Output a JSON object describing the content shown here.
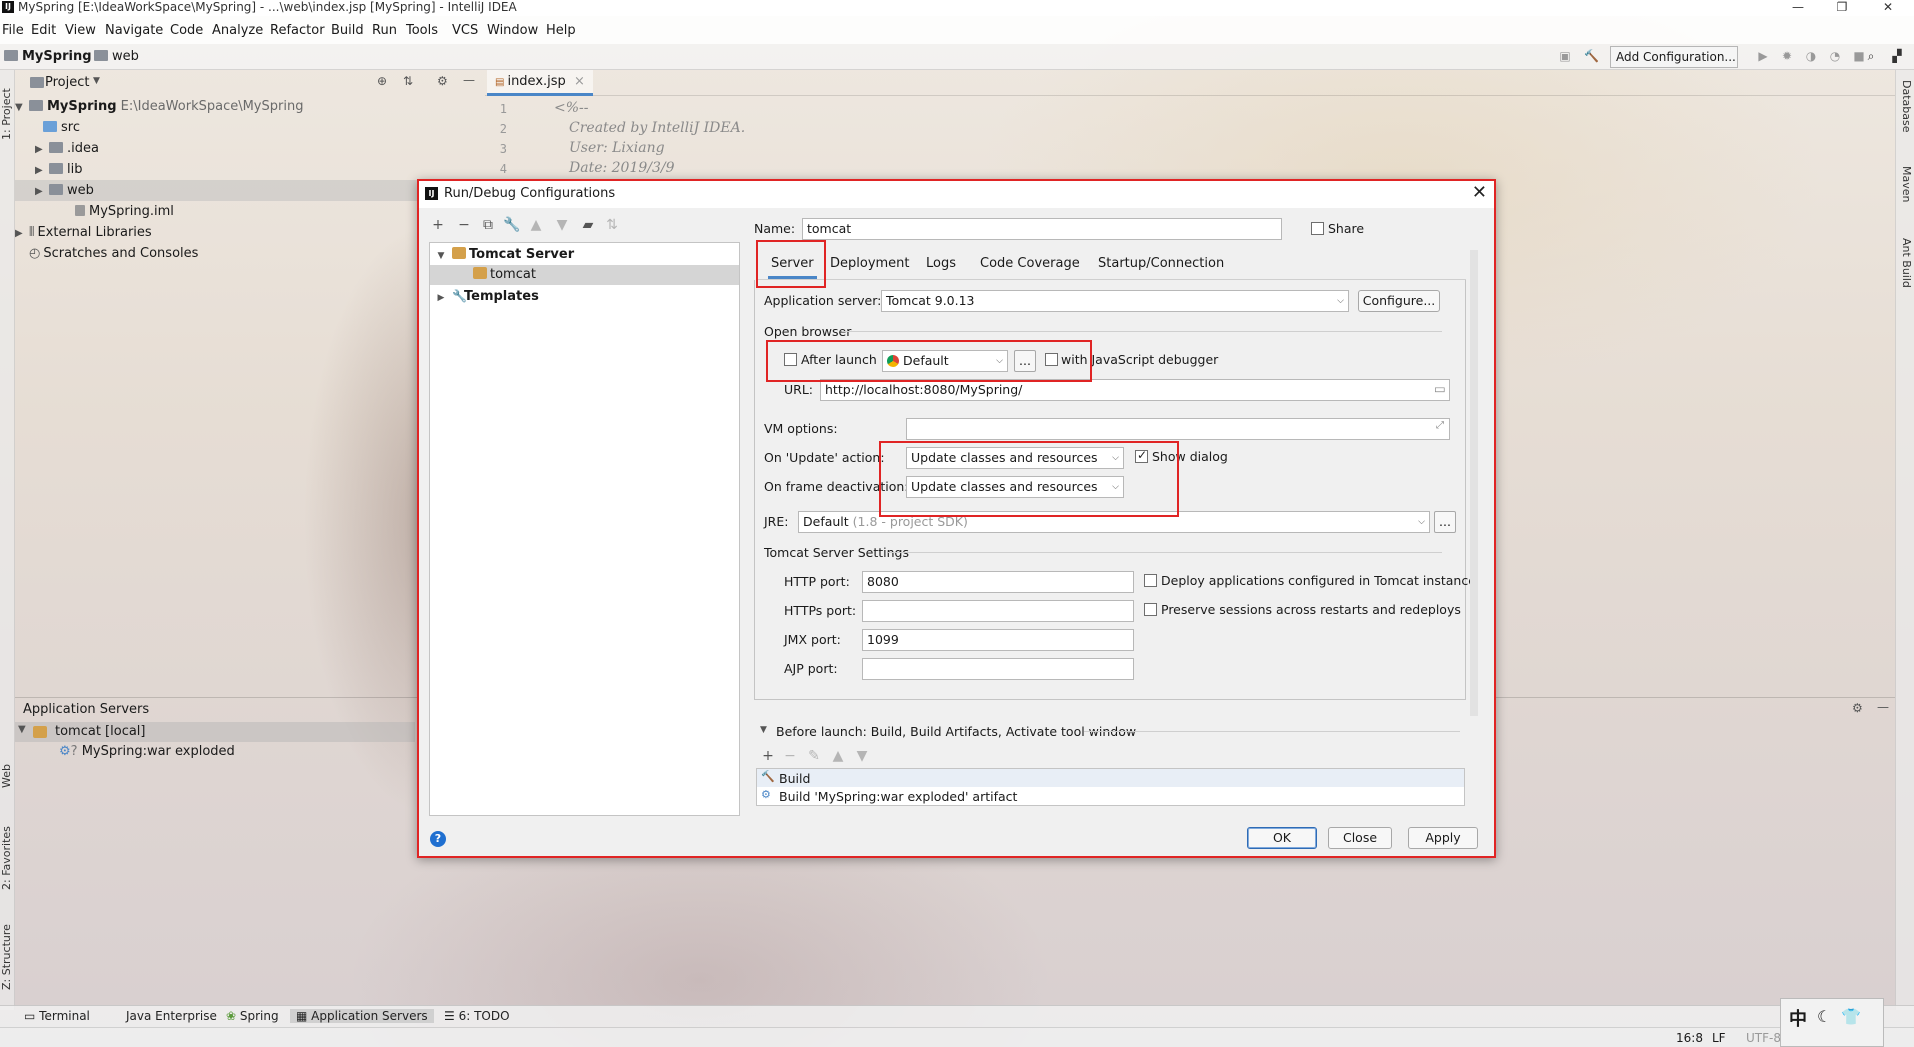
{
  "window": {
    "title": "MySpring [E:\\IdeaWorkSpace\\MySpring] - ...\\web\\index.jsp [MySpring] - IntelliJ IDEA",
    "minimize": "—",
    "restore": "❐",
    "close": "✕"
  },
  "menu": [
    "File",
    "Edit",
    "View",
    "Navigate",
    "Code",
    "Analyze",
    "Refactor",
    "Build",
    "Run",
    "Tools",
    "VCS",
    "Window",
    "Help"
  ],
  "navbar": {
    "project": "MySpring",
    "folder": "web",
    "add_config": "Add Configuration..."
  },
  "left_tabs": {
    "project": "1: Project",
    "web": "Web",
    "favorites": "2: Favorites",
    "structure": "Z: Structure"
  },
  "right_tabs": {
    "database": "Database",
    "maven": "Maven",
    "ant": "Ant Build"
  },
  "project_panel": {
    "title": "Project",
    "root": {
      "name": "MySpring",
      "path": "E:\\IdeaWorkSpace\\MySpring"
    },
    "items": [
      {
        "label": "src"
      },
      {
        "label": ".idea"
      },
      {
        "label": "lib"
      },
      {
        "label": "web"
      },
      {
        "label": "MySpring.iml"
      },
      {
        "label": "External Libraries"
      },
      {
        "label": "Scratches and Consoles"
      }
    ]
  },
  "editor": {
    "tab": "index.jsp",
    "lines": [
      "1",
      "2",
      "3",
      "4"
    ],
    "code": [
      "<%--",
      "Created by IntelliJ IDEA.",
      "User: Lixiang",
      "Date: 2019/3/9"
    ]
  },
  "app_servers": {
    "title": "Application Servers",
    "server": "tomcat [local]",
    "artifact": "MySpring:war exploded"
  },
  "bottom_tabs": [
    "Terminal",
    "Java Enterprise",
    "Spring",
    "Application Servers",
    "6: TODO"
  ],
  "status": {
    "position": "16:8",
    "line_sep": "LF",
    "encoding": "UTF-8"
  },
  "ime": "中",
  "dialog": {
    "title": "Run/Debug Configurations",
    "tree": {
      "group": "Tomcat Server",
      "config": "tomcat",
      "templates": "Templates"
    },
    "name_label": "Name:",
    "name_value": "tomcat",
    "share_label": "Share",
    "tabs": [
      "Server",
      "Deployment",
      "Logs",
      "Code Coverage",
      "Startup/Connection"
    ],
    "app_server_label": "Application server:",
    "app_server_value": "Tomcat 9.0.13",
    "configure_btn": "Configure...",
    "open_browser_label": "Open browser",
    "after_launch_label": "After launch",
    "browser_value": "Default",
    "browse_btn": "...",
    "js_debugger_label": "with JavaScript debugger",
    "url_label": "URL:",
    "url_value": "http://localhost:8080/MySpring/",
    "vm_options_label": "VM options:",
    "vm_options_value": "",
    "on_update_label": "On 'Update' action:",
    "on_update_value": "Update classes and resources",
    "show_dialog_label": "Show dialog",
    "on_frame_label": "On frame deactivation:",
    "on_frame_value": "Update classes and resources",
    "jre_label": "JRE:",
    "jre_value": "Default",
    "jre_hint": "(1.8 - project SDK)",
    "tomcat_settings_label": "Tomcat Server Settings",
    "http_port_label": "HTTP port:",
    "http_port_value": "8080",
    "https_port_label": "HTTPs port:",
    "https_port_value": "",
    "jmx_port_label": "JMX port:",
    "jmx_port_value": "1099",
    "ajp_port_label": "AJP port:",
    "ajp_port_value": "",
    "deploy_label": "Deploy applications configured in Tomcat instance",
    "preserve_label": "Preserve sessions across restarts and redeploys",
    "before_launch_label": "Before launch: Build, Build Artifacts, Activate tool window",
    "before_launch_items": [
      "Build",
      "Build 'MySpring:war exploded' artifact"
    ],
    "ok": "OK",
    "close": "Close",
    "apply": "Apply",
    "help": "?"
  },
  "colors": {
    "highlight": "#e02424",
    "accent": "#4a86c7"
  }
}
